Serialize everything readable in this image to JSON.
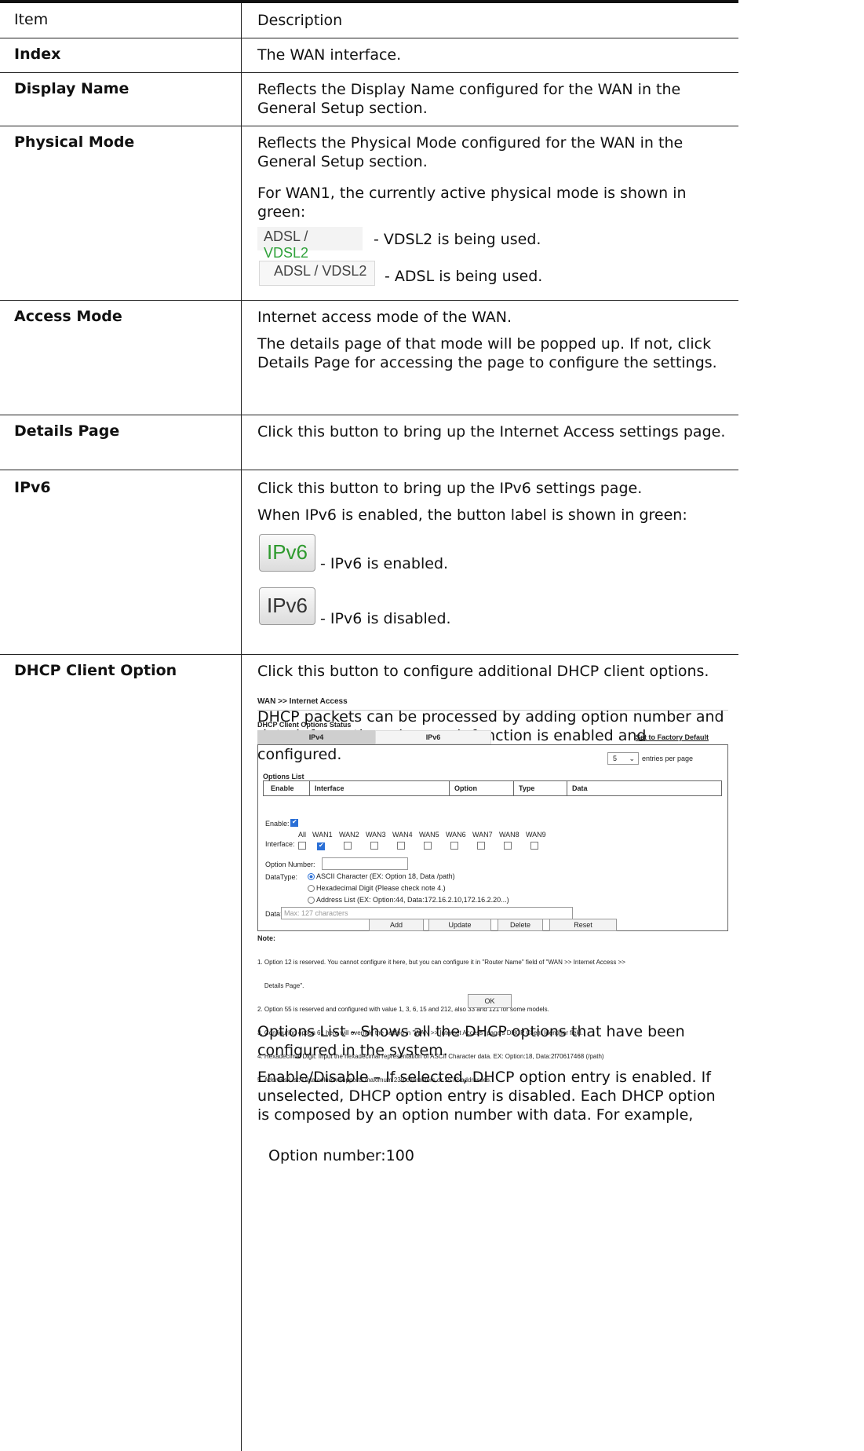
{
  "header": {
    "item": "Item",
    "description": "Description"
  },
  "rows": {
    "index": {
      "item": "Index",
      "desc": "The WAN interface."
    },
    "display_name": {
      "item": "Display Name",
      "desc": "Reflects the Display Name configured for the WAN in the General Setup section."
    },
    "physical_mode": {
      "item": "Physical Mode",
      "desc1": "Reflects the Physical Mode configured for the WAN in the General Setup section.",
      "desc2": "For WAN1, the currently active physical mode is shown in green:",
      "img_adsl": "ADSL",
      "img_slash": " / ",
      "img_vdsl": "VDSL2",
      "img_combined": "ADSL / VDSL2",
      "vdsl_note": "- VDSL2 is being used.",
      "adsl_note": "- ADSL is being used."
    },
    "access_mode": {
      "item": "Access Mode",
      "desc1": "Internet access mode of the WAN.",
      "desc2": "The details page of that mode will be popped up. If not, click Details Page for accessing the page to configure the settings."
    },
    "details_page": {
      "item": "Details Page",
      "desc": "Click this button to bring up the Internet Access settings page."
    },
    "ipv6": {
      "item": "IPv6",
      "desc1": "Click this button to bring up the IPv6 settings page.",
      "desc2": "When IPv6 is enabled, the button label is shown in green:",
      "btn_label": "IPv6",
      "enabled_note": "- IPv6 is enabled.",
      "disabled_note": "- IPv6 is disabled."
    },
    "dhcp": {
      "item": "DHCP Client Option",
      "desc1": "Click this button to configure additional DHCP client options.",
      "desc2": "DHCP packets can be processed by adding option number and data information when such function is enabled and configured.",
      "options_list_label": "Options List",
      "options_list_text": " - Shows all the DHCP options that have been configured in the system.",
      "enable_label": "Enable/Disable",
      "enable_text": " – If selected, DHCP option entry is enabled. If unselected, DHCP option entry is disabled. Each DHCP option is composed by an option number with data. For example,",
      "example": "Option number:100"
    }
  },
  "shot": {
    "breadcrumb": "WAN >> Internet Access",
    "section_title": "DHCP Client Options Status",
    "tab_ipv4": "IPv4",
    "tab_ipv6": "IPv6",
    "factory_link": "Set to Factory Default",
    "per_page_value": "5",
    "per_page_label": "entries per page",
    "options_list": "Options List",
    "columns": [
      "Enable",
      "Interface",
      "Option",
      "Type",
      "Data"
    ],
    "enable_label": "Enable:",
    "interface_label": "Interface:",
    "interfaces": [
      "All",
      "WAN1",
      "WAN2",
      "WAN3",
      "WAN4",
      "WAN5",
      "WAN6",
      "WAN7",
      "WAN8",
      "WAN9"
    ],
    "option_number_label": "Option Number:",
    "datatype_label": "DataType:",
    "datatype_ascii": "ASCII Character (EX: Option 18, Data /path)",
    "datatype_hex": "Hexadecimal Digit (Please check note 4.)",
    "datatype_addr": "Address List (EX: Option:44, Data:172.16.2.10,172.16.2.20...)",
    "data_label": "Data:",
    "data_placeholder": "Max: 127 characters",
    "btn_add": "Add",
    "btn_update": "Update",
    "btn_delete": "Delete",
    "btn_reset": "Reset",
    "note_title": "Note:",
    "notes": [
      "1. Option 12 is reserved. You cannot configure it here, but you can configure it in \"Router Name\" field of \"WAN >> Internet Access >>",
      "    Details Page\".",
      "2. Option 55 is reserved and configured with value 1, 3, 6, 15 and 212, also 33 and 121 for some models.",
      "3. Configuring option 61 here will override the setting in \"WAN >> Internet Access\" page's DHCP Client Identifier field.",
      "4. Hexadecimal Digit: Input the hexadecimal representation of ASCII Character data. EX: Option:18, Data:2f70617468 (/path)",
      "5. Address List: Data column supports maximum 239 characters or 15 IP addresses."
    ],
    "btn_ok": "OK"
  }
}
